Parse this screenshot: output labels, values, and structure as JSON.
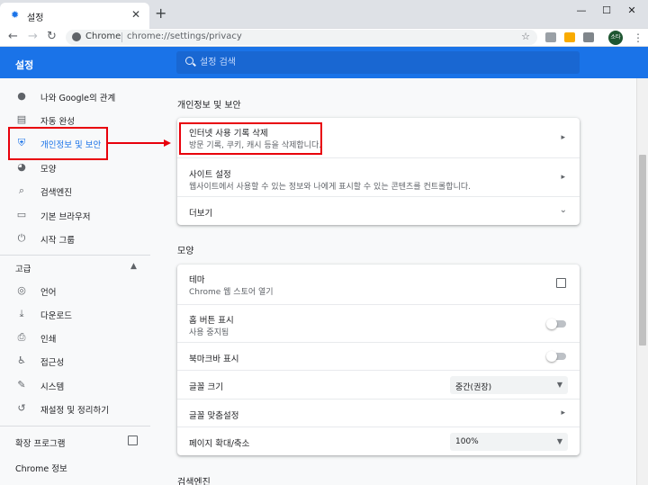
{
  "tab": {
    "title": "설정",
    "favicon": "gear-icon"
  },
  "toolbar": {
    "site_label": "Chrome",
    "url": "chrome://settings/privacy",
    "profile_label": "소타"
  },
  "header": {
    "title": "설정",
    "search_placeholder": "설정 검색"
  },
  "sidebar": {
    "items": [
      {
        "label": "나와 Google의 관계",
        "icon": "person-icon"
      },
      {
        "label": "자동 완성",
        "icon": "clipboard-icon"
      },
      {
        "label": "개인정보 및 보안",
        "icon": "shield-icon"
      },
      {
        "label": "모양",
        "icon": "palette-icon"
      },
      {
        "label": "검색엔진",
        "icon": "search-icon"
      },
      {
        "label": "기본 브라우저",
        "icon": "browser-icon"
      },
      {
        "label": "시작 그룹",
        "icon": "power-icon"
      }
    ],
    "advanced_label": "고급",
    "advanced_items": [
      {
        "label": "언어",
        "icon": "globe-icon"
      },
      {
        "label": "다운로드",
        "icon": "download-icon"
      },
      {
        "label": "인쇄",
        "icon": "printer-icon"
      },
      {
        "label": "접근성",
        "icon": "accessibility-icon"
      },
      {
        "label": "시스템",
        "icon": "wrench-icon"
      },
      {
        "label": "재설정 및 정리하기",
        "icon": "history-icon"
      }
    ],
    "extensions_label": "확장 프로그램",
    "about_label": "Chrome 정보"
  },
  "privacy": {
    "title": "개인정보 및 보안",
    "rows": [
      {
        "title": "인터넷 사용 기록 삭제",
        "subtitle": "방문 기록, 쿠키, 캐시 등을 삭제합니다."
      },
      {
        "title": "사이트 설정",
        "subtitle": "웹사이트에서 사용할 수 있는 정보와 나에게 표시할 수 있는 콘텐츠를 컨트롤합니다."
      }
    ],
    "more_label": "더보기"
  },
  "appearance": {
    "title": "모양",
    "theme_title": "테마",
    "theme_subtitle": "Chrome 웹 스토어 열기",
    "home_title": "홈 버튼 표시",
    "home_subtitle": "사용 중지됨",
    "bookmarks_title": "북마크바 표시",
    "font_size_title": "글꼴 크기",
    "font_size_value": "중간(권장)",
    "customize_fonts_title": "글꼴 맞춤설정",
    "zoom_title": "페이지 확대/축소",
    "zoom_value": "100%"
  },
  "search_engine_title": "검색엔진",
  "colors": {
    "accent": "#1a73e8",
    "annotation": "#e8000b"
  }
}
